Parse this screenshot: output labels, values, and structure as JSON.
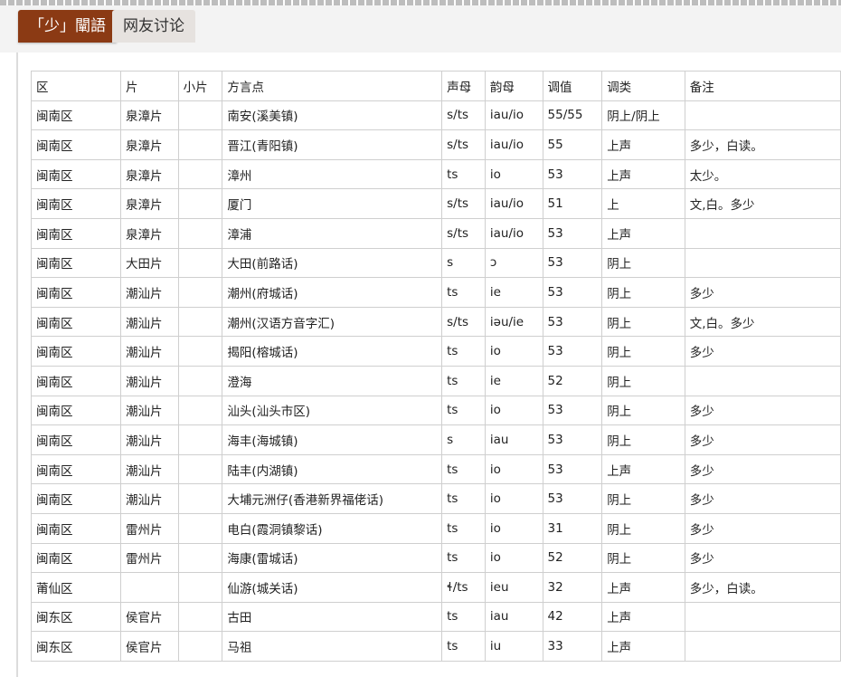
{
  "tabs": [
    {
      "label": "「少」闡語",
      "active": true
    },
    {
      "label": "网友讨论",
      "active": false
    }
  ],
  "colors": {
    "accent": "#8b3a14",
    "tab_inactive": "#e6e2df",
    "border": "#cfcfcf"
  },
  "table": {
    "headers": [
      "区",
      "片",
      "小片",
      "方言点",
      "声母",
      "韵母",
      "调值",
      "调类",
      "备注"
    ],
    "rows": [
      [
        "闽南区",
        "泉漳片",
        "",
        "南安(溪美镇)",
        "s/ts",
        "iau/io",
        "55/55",
        "阴上/阴上",
        ""
      ],
      [
        "闽南区",
        "泉漳片",
        "",
        "晋江(青阳镇)",
        "s/ts",
        "iau/io",
        "55",
        "上声",
        "多少，白读。"
      ],
      [
        "闽南区",
        "泉漳片",
        "",
        "漳州",
        "ts",
        "io",
        "53",
        "上声",
        "太少。"
      ],
      [
        "闽南区",
        "泉漳片",
        "",
        "厦门",
        "s/ts",
        "iau/io",
        "51",
        "上",
        "文,白。多少"
      ],
      [
        "闽南区",
        "泉漳片",
        "",
        "漳浦",
        "s/ts",
        "iau/io",
        "53",
        "上声",
        ""
      ],
      [
        "闽南区",
        "大田片",
        "",
        "大田(前路话)",
        "s",
        "ɔ",
        "53",
        "阴上",
        ""
      ],
      [
        "闽南区",
        "潮汕片",
        "",
        "潮州(府城话)",
        "ts",
        "ie",
        "53",
        "阴上",
        "多少"
      ],
      [
        "闽南区",
        "潮汕片",
        "",
        "潮州(汉语方音字汇)",
        "s/ts",
        "iəu/ie",
        "53",
        "阴上",
        "文,白。多少"
      ],
      [
        "闽南区",
        "潮汕片",
        "",
        "揭阳(榕城话)",
        "ts",
        "io",
        "53",
        "阴上",
        "多少"
      ],
      [
        "闽南区",
        "潮汕片",
        "",
        "澄海",
        "ts",
        "ie",
        "52",
        "阴上",
        ""
      ],
      [
        "闽南区",
        "潮汕片",
        "",
        "汕头(汕头市区)",
        "ts",
        "io",
        "53",
        "阴上",
        "多少"
      ],
      [
        "闽南区",
        "潮汕片",
        "",
        "海丰(海城镇)",
        "s",
        "iau",
        "53",
        "阴上",
        "多少"
      ],
      [
        "闽南区",
        "潮汕片",
        "",
        "陆丰(内湖镇)",
        "ts",
        "io",
        "53",
        "上声",
        "多少"
      ],
      [
        "闽南区",
        "潮汕片",
        "",
        "大埔元洲仔(香港新界福佬话)",
        "ts",
        "io",
        "53",
        "阴上",
        "多少"
      ],
      [
        "闽南区",
        "雷州片",
        "",
        "电白(霞洞镇黎话)",
        "ts",
        "io",
        "31",
        "阴上",
        "多少"
      ],
      [
        "闽南区",
        "雷州片",
        "",
        "海康(雷城话)",
        "ts",
        "io",
        "52",
        "阴上",
        "多少"
      ],
      [
        "莆仙区",
        "",
        "",
        "仙游(城关话)",
        "ɬ/ts",
        "ieu",
        "32",
        "上声",
        "多少，白读。"
      ],
      [
        "闽东区",
        "侯官片",
        "",
        "古田",
        "ts",
        "iau",
        "42",
        "上声",
        ""
      ],
      [
        "闽东区",
        "侯官片",
        "",
        "马祖",
        "ts",
        "iu",
        "33",
        "上声",
        ""
      ]
    ]
  }
}
